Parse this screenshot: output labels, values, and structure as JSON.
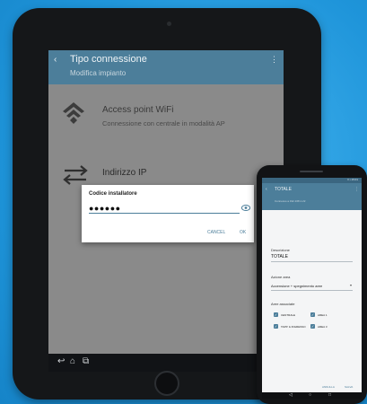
{
  "tablet": {
    "appbar": {
      "title": "Tipo connessione",
      "subtitle": "Modifica impianto",
      "back_glyph": "‹",
      "menu_glyph": "⋮"
    },
    "options": [
      {
        "title": "Access point WiFi",
        "subtitle": "Connessione con centrale in modalità AP",
        "icon": "wifi-icon"
      },
      {
        "title": "Indirizzo IP",
        "icon": "arrows-icon"
      }
    ],
    "dialog": {
      "title": "Codice installatore",
      "value": "●●●●●●",
      "cancel_label": "CANCEL",
      "ok_label": "OK"
    },
    "navbar": {
      "back": "↩",
      "home": "⌂",
      "recent": "⧉"
    }
  },
  "phone": {
    "status_text": "▾ ▪ 15:01",
    "appbar": {
      "title": "TOTALE",
      "subtitle": "Connesso a 192.168.1.22",
      "back_glyph": "‹",
      "menu_glyph": "⋮"
    },
    "fields": {
      "descrizione_label": "Descrizione",
      "descrizione_value": "TOTALE",
      "azione_label": "Azione area",
      "azione_value": "Accensione + spegnimento aree",
      "aree_label": "Aree associate"
    },
    "checkboxes": [
      {
        "label": "CENTRALE",
        "checked": true
      },
      {
        "label": "AREA 1",
        "checked": true
      },
      {
        "label": "TAPP. & INGRESSO",
        "checked": true
      },
      {
        "label": "AREA 3",
        "checked": true
      }
    ],
    "buttons": {
      "cancel": "ANNULLA",
      "save": "SALVA"
    },
    "navbar": {
      "back": "◁",
      "home": "○",
      "recent": "□"
    }
  },
  "colors": {
    "background": "#2a9fe0",
    "appbar": "#4c7e9a",
    "dim_overlay": "#8a8a8a"
  }
}
